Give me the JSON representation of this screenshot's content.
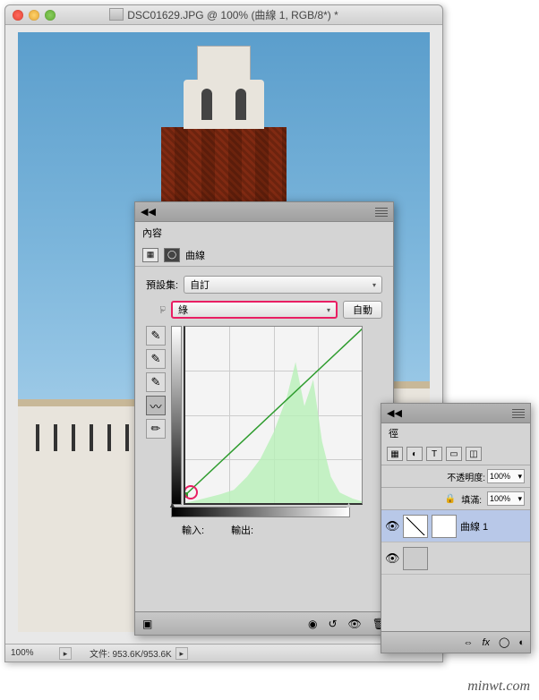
{
  "doc": {
    "title": "DSC01629.JPG @ 100% (曲線 1, RGB/8*) *",
    "zoom": "100%",
    "status": "文件: 953.6K/953.6K"
  },
  "props": {
    "panel_title": "內容",
    "adj_type": "曲線",
    "preset_label": "預設集:",
    "preset_value": "自訂",
    "channel_value": "綠",
    "auto_label": "自動",
    "input_label": "輸入:",
    "output_label": "輸出:"
  },
  "layers": {
    "tab": "徑",
    "opacity_label": "不透明度:",
    "opacity_value": "100%",
    "fill_label": "填滿:",
    "fill_value": "100%",
    "layer1": "曲線 1"
  },
  "watermark": "minwt.com"
}
